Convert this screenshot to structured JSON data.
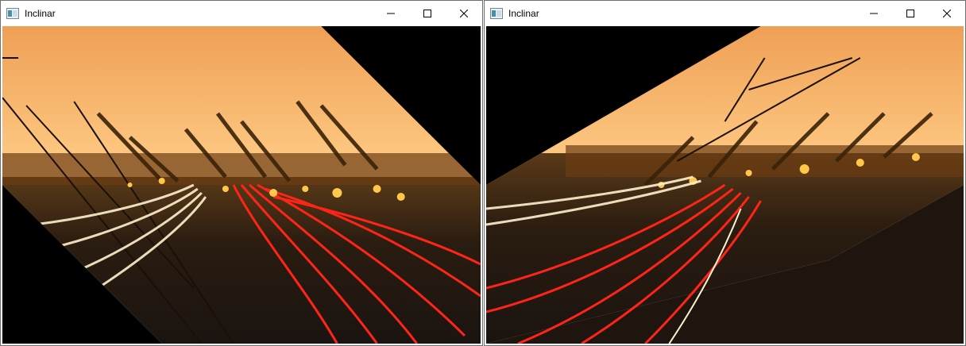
{
  "windows": [
    {
      "title": "Inclinar",
      "icon": "opencv-window-icon",
      "controls": [
        "minimize",
        "maximize",
        "close"
      ],
      "image": {
        "description_name": "sheared-highway-image-left"
      }
    },
    {
      "title": "Inclinar",
      "icon": "opencv-window-icon",
      "controls": [
        "minimize",
        "maximize",
        "close"
      ],
      "image": {
        "description_name": "sheared-highway-image-right"
      }
    }
  ],
  "colors": {
    "sky_top": "#f0a65a",
    "sky_bottom": "#ffcf8a",
    "road": "#2a1e14",
    "light_red": "#ff2a1a",
    "light_white": "#fff4d8",
    "light_yellow": "#ffc44a",
    "background": "#000000"
  }
}
